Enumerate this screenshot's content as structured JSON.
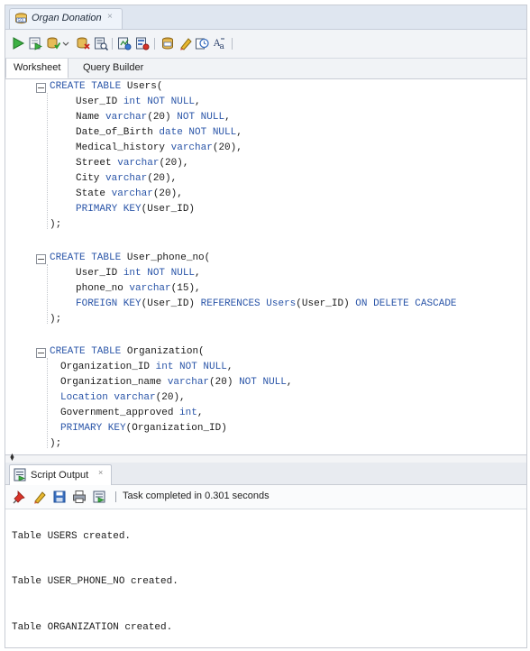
{
  "doc_tab": {
    "title": "Organ Donation",
    "close_glyph": "×"
  },
  "toolbar": {
    "items": [
      "run-statement-icon",
      "run-script-icon",
      "commit-icon",
      "rollback-icon",
      "explain-plan-icon",
      "autotrace-icon",
      "sql-tuning-icon",
      "unshared-sql-icon",
      "clear-icon",
      "sql-history-icon",
      "format-icon"
    ]
  },
  "worksheet_tabs": [
    {
      "label": "Worksheet",
      "active": true
    },
    {
      "label": "Query Builder",
      "active": false
    }
  ],
  "code": {
    "blocks": [
      {
        "lines": [
          [
            {
              "t": "CREATE TABLE ",
              "k": true
            },
            {
              "t": "Users(",
              "k": false
            }
          ],
          [
            {
              "t": "User_ID ",
              "k": false
            },
            {
              "t": "int NOT NULL",
              "k": true
            },
            {
              "t": ",",
              "k": false
            }
          ],
          [
            {
              "t": "Name ",
              "k": false
            },
            {
              "t": "varchar",
              "k": true
            },
            {
              "t": "(20) ",
              "k": false
            },
            {
              "t": "NOT NULL",
              "k": true
            },
            {
              "t": ",",
              "k": false
            }
          ],
          [
            {
              "t": "Date_of_Birth ",
              "k": false
            },
            {
              "t": "date NOT NULL",
              "k": true
            },
            {
              "t": ",",
              "k": false
            }
          ],
          [
            {
              "t": "Medical_history ",
              "k": false
            },
            {
              "t": "varchar",
              "k": true
            },
            {
              "t": "(20),",
              "k": false
            }
          ],
          [
            {
              "t": "Street ",
              "k": false
            },
            {
              "t": "varchar",
              "k": true
            },
            {
              "t": "(20),",
              "k": false
            }
          ],
          [
            {
              "t": "City ",
              "k": false
            },
            {
              "t": "varchar",
              "k": true
            },
            {
              "t": "(20),",
              "k": false
            }
          ],
          [
            {
              "t": "State ",
              "k": false
            },
            {
              "t": "varchar",
              "k": true
            },
            {
              "t": "(20),",
              "k": false
            }
          ],
          [
            {
              "t": "PRIMARY KEY",
              "k": true
            },
            {
              "t": "(User_ID)",
              "k": false
            }
          ],
          [
            {
              "t": ");",
              "k": false
            }
          ]
        ]
      },
      {
        "lines": [
          [
            {
              "t": "CREATE TABLE ",
              "k": true
            },
            {
              "t": "User_phone_no(",
              "k": false
            }
          ],
          [
            {
              "t": "User_ID ",
              "k": false
            },
            {
              "t": "int NOT NULL",
              "k": true
            },
            {
              "t": ",",
              "k": false
            }
          ],
          [
            {
              "t": "phone_no ",
              "k": false
            },
            {
              "t": "varchar",
              "k": true
            },
            {
              "t": "(15),",
              "k": false
            }
          ],
          [
            {
              "t": "FOREIGN KEY",
              "k": true
            },
            {
              "t": "(User_ID) ",
              "k": false
            },
            {
              "t": "REFERENCES ",
              "k": true
            },
            {
              "t": "Users",
              "k": true
            },
            {
              "t": "(User_ID) ",
              "k": false
            },
            {
              "t": "ON DELETE CASCADE",
              "k": true
            }
          ],
          [
            {
              "t": ");",
              "k": false
            }
          ]
        ]
      },
      {
        "lines": [
          [
            {
              "t": "CREATE TABLE ",
              "k": true
            },
            {
              "t": "Organization(",
              "k": false
            }
          ],
          [
            {
              "t": "Organization_ID ",
              "k": false
            },
            {
              "t": "int NOT NULL",
              "k": true
            },
            {
              "t": ",",
              "k": false
            }
          ],
          [
            {
              "t": "Organization_name ",
              "k": false
            },
            {
              "t": "varchar",
              "k": true
            },
            {
              "t": "(20) ",
              "k": false
            },
            {
              "t": "NOT NULL",
              "k": true
            },
            {
              "t": ",",
              "k": false
            }
          ],
          [
            {
              "t": "Location ",
              "k": true
            },
            {
              "t": "varchar",
              "k": true
            },
            {
              "t": "(20),",
              "k": false
            }
          ],
          [
            {
              "t": "Government_approved ",
              "k": false
            },
            {
              "t": "int",
              "k": true
            },
            {
              "t": ",",
              "k": false
            }
          ],
          [
            {
              "t": "PRIMARY KEY",
              "k": true
            },
            {
              "t": "(Organization_ID)",
              "k": false
            }
          ],
          [
            {
              "t": ");",
              "k": false
            }
          ]
        ]
      }
    ]
  },
  "output_tab": {
    "title": "Script Output",
    "close_glyph": "×"
  },
  "output_toolbar": {
    "items": [
      "pin-icon",
      "clear-output-icon",
      "save-icon",
      "print-icon",
      "buffer-size-icon"
    ],
    "status": "Task completed in 0.301 seconds"
  },
  "output_lines": [
    "Table USERS created.",
    "Table USER_PHONE_NO created.",
    "Table ORGANIZATION created."
  ]
}
